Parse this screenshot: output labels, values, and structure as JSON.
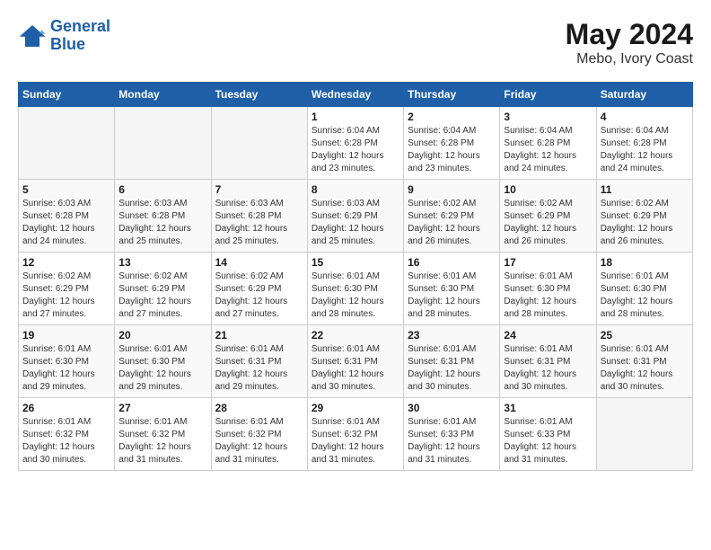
{
  "logo": {
    "line1": "General",
    "line2": "Blue"
  },
  "title": "May 2024",
  "subtitle": "Mebo, Ivory Coast",
  "weekdays": [
    "Sunday",
    "Monday",
    "Tuesday",
    "Wednesday",
    "Thursday",
    "Friday",
    "Saturday"
  ],
  "weeks": [
    [
      {
        "day": "",
        "info": ""
      },
      {
        "day": "",
        "info": ""
      },
      {
        "day": "",
        "info": ""
      },
      {
        "day": "1",
        "info": "Sunrise: 6:04 AM\nSunset: 6:28 PM\nDaylight: 12 hours\nand 23 minutes."
      },
      {
        "day": "2",
        "info": "Sunrise: 6:04 AM\nSunset: 6:28 PM\nDaylight: 12 hours\nand 23 minutes."
      },
      {
        "day": "3",
        "info": "Sunrise: 6:04 AM\nSunset: 6:28 PM\nDaylight: 12 hours\nand 24 minutes."
      },
      {
        "day": "4",
        "info": "Sunrise: 6:04 AM\nSunset: 6:28 PM\nDaylight: 12 hours\nand 24 minutes."
      }
    ],
    [
      {
        "day": "5",
        "info": "Sunrise: 6:03 AM\nSunset: 6:28 PM\nDaylight: 12 hours\nand 24 minutes."
      },
      {
        "day": "6",
        "info": "Sunrise: 6:03 AM\nSunset: 6:28 PM\nDaylight: 12 hours\nand 25 minutes."
      },
      {
        "day": "7",
        "info": "Sunrise: 6:03 AM\nSunset: 6:28 PM\nDaylight: 12 hours\nand 25 minutes."
      },
      {
        "day": "8",
        "info": "Sunrise: 6:03 AM\nSunset: 6:29 PM\nDaylight: 12 hours\nand 25 minutes."
      },
      {
        "day": "9",
        "info": "Sunrise: 6:02 AM\nSunset: 6:29 PM\nDaylight: 12 hours\nand 26 minutes."
      },
      {
        "day": "10",
        "info": "Sunrise: 6:02 AM\nSunset: 6:29 PM\nDaylight: 12 hours\nand 26 minutes."
      },
      {
        "day": "11",
        "info": "Sunrise: 6:02 AM\nSunset: 6:29 PM\nDaylight: 12 hours\nand 26 minutes."
      }
    ],
    [
      {
        "day": "12",
        "info": "Sunrise: 6:02 AM\nSunset: 6:29 PM\nDaylight: 12 hours\nand 27 minutes."
      },
      {
        "day": "13",
        "info": "Sunrise: 6:02 AM\nSunset: 6:29 PM\nDaylight: 12 hours\nand 27 minutes."
      },
      {
        "day": "14",
        "info": "Sunrise: 6:02 AM\nSunset: 6:29 PM\nDaylight: 12 hours\nand 27 minutes."
      },
      {
        "day": "15",
        "info": "Sunrise: 6:01 AM\nSunset: 6:30 PM\nDaylight: 12 hours\nand 28 minutes."
      },
      {
        "day": "16",
        "info": "Sunrise: 6:01 AM\nSunset: 6:30 PM\nDaylight: 12 hours\nand 28 minutes."
      },
      {
        "day": "17",
        "info": "Sunrise: 6:01 AM\nSunset: 6:30 PM\nDaylight: 12 hours\nand 28 minutes."
      },
      {
        "day": "18",
        "info": "Sunrise: 6:01 AM\nSunset: 6:30 PM\nDaylight: 12 hours\nand 28 minutes."
      }
    ],
    [
      {
        "day": "19",
        "info": "Sunrise: 6:01 AM\nSunset: 6:30 PM\nDaylight: 12 hours\nand 29 minutes."
      },
      {
        "day": "20",
        "info": "Sunrise: 6:01 AM\nSunset: 6:30 PM\nDaylight: 12 hours\nand 29 minutes."
      },
      {
        "day": "21",
        "info": "Sunrise: 6:01 AM\nSunset: 6:31 PM\nDaylight: 12 hours\nand 29 minutes."
      },
      {
        "day": "22",
        "info": "Sunrise: 6:01 AM\nSunset: 6:31 PM\nDaylight: 12 hours\nand 30 minutes."
      },
      {
        "day": "23",
        "info": "Sunrise: 6:01 AM\nSunset: 6:31 PM\nDaylight: 12 hours\nand 30 minutes."
      },
      {
        "day": "24",
        "info": "Sunrise: 6:01 AM\nSunset: 6:31 PM\nDaylight: 12 hours\nand 30 minutes."
      },
      {
        "day": "25",
        "info": "Sunrise: 6:01 AM\nSunset: 6:31 PM\nDaylight: 12 hours\nand 30 minutes."
      }
    ],
    [
      {
        "day": "26",
        "info": "Sunrise: 6:01 AM\nSunset: 6:32 PM\nDaylight: 12 hours\nand 30 minutes."
      },
      {
        "day": "27",
        "info": "Sunrise: 6:01 AM\nSunset: 6:32 PM\nDaylight: 12 hours\nand 31 minutes."
      },
      {
        "day": "28",
        "info": "Sunrise: 6:01 AM\nSunset: 6:32 PM\nDaylight: 12 hours\nand 31 minutes."
      },
      {
        "day": "29",
        "info": "Sunrise: 6:01 AM\nSunset: 6:32 PM\nDaylight: 12 hours\nand 31 minutes."
      },
      {
        "day": "30",
        "info": "Sunrise: 6:01 AM\nSunset: 6:33 PM\nDaylight: 12 hours\nand 31 minutes."
      },
      {
        "day": "31",
        "info": "Sunrise: 6:01 AM\nSunset: 6:33 PM\nDaylight: 12 hours\nand 31 minutes."
      },
      {
        "day": "",
        "info": ""
      }
    ]
  ]
}
